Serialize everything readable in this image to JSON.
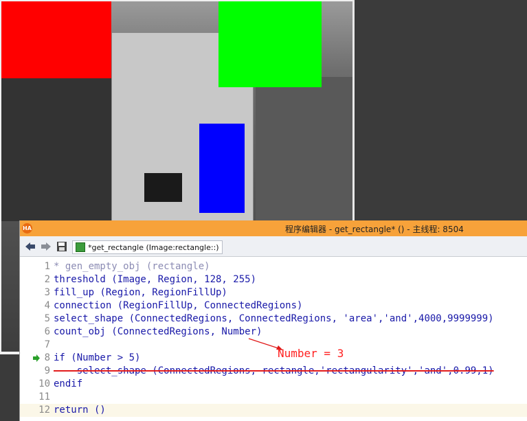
{
  "graphics_window": {
    "region_colors": {
      "red": "#ff0000",
      "green": "#00ff00",
      "blue": "#0000ff"
    }
  },
  "editor": {
    "title": "程序编辑器 - get_rectangle* () - 主线程: 8504",
    "logo": "HA",
    "tab_label": "*get_rectangle (Image:rectangle::)",
    "accent_color": "#f7a23a",
    "lines": [
      {
        "num": "1",
        "text": "* gen_empty_obj (rectangle)"
      },
      {
        "num": "2",
        "text": "threshold (Image, Region, 128, 255)"
      },
      {
        "num": "3",
        "text": "fill_up (Region, RegionFillUp)"
      },
      {
        "num": "4",
        "text": "connection (RegionFillUp, ConnectedRegions)"
      },
      {
        "num": "5",
        "text": "select_shape (ConnectedRegions, ConnectedRegions, 'area','and',4000,9999999)"
      },
      {
        "num": "6",
        "text": "count_obj (ConnectedRegions, Number)"
      },
      {
        "num": "7",
        "text": ""
      },
      {
        "num": "8",
        "text": "if (Number > 5)"
      },
      {
        "num": "9",
        "text": "    select_shape (ConnectedRegions, rectangle,'rectangularity','and',0.99,1)"
      },
      {
        "num": "10",
        "text": "endif"
      },
      {
        "num": "11",
        "text": ""
      },
      {
        "num": "12",
        "text": "return ()"
      }
    ]
  },
  "annotation": {
    "text": "Number = 3",
    "color": "#ff2020"
  },
  "icons": [
    "back-arrow-icon",
    "forward-arrow-icon",
    "save-icon",
    "procedure-icon",
    "pc-arrow-icon"
  ]
}
